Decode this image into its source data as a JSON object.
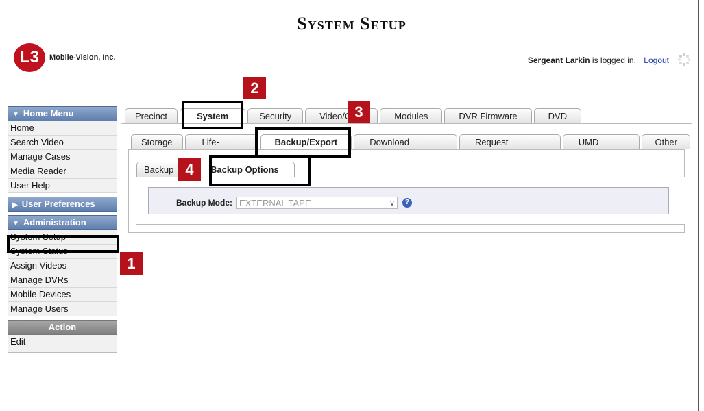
{
  "header": {
    "title": "System Setup",
    "logo_badge": "L3",
    "logo_text": "Mobile-Vision, Inc.",
    "user_name": "Sergeant Larkin",
    "user_status": " is logged in.",
    "logout": "Logout"
  },
  "sidebar": {
    "home_menu": "Home Menu",
    "home_items": [
      "Home",
      "Search Video",
      "Manage Cases",
      "Media Reader",
      "User Help"
    ],
    "user_prefs": "User Preferences",
    "administration": "Administration",
    "admin_items": [
      "System Setup",
      "System Status",
      "Assign Videos",
      "Manage DVRs",
      "Mobile Devices",
      "Manage Users"
    ],
    "action": "Action",
    "action_items": [
      "Edit"
    ]
  },
  "tabs_level1": [
    "Precinct",
    "System",
    "Security",
    "Video/GPS",
    "Modules",
    "DVR Firmware",
    "DVD"
  ],
  "tabs_level2": [
    "Storage",
    "Life-Cycle",
    "Backup/Export",
    "Download Options",
    "Request Reasons",
    "UMD Types",
    "Other"
  ],
  "tabs_level3": [
    "Backup",
    "Backup Options"
  ],
  "form": {
    "backup_mode_label": "Backup Mode:",
    "backup_mode_value": "EXTERNAL TAPE",
    "help": "?"
  },
  "callouts": [
    "1",
    "2",
    "3",
    "4"
  ],
  "colors": {
    "callout": "#b5121b",
    "menu_header": "#6a88b8",
    "link": "#1c3fa8"
  }
}
